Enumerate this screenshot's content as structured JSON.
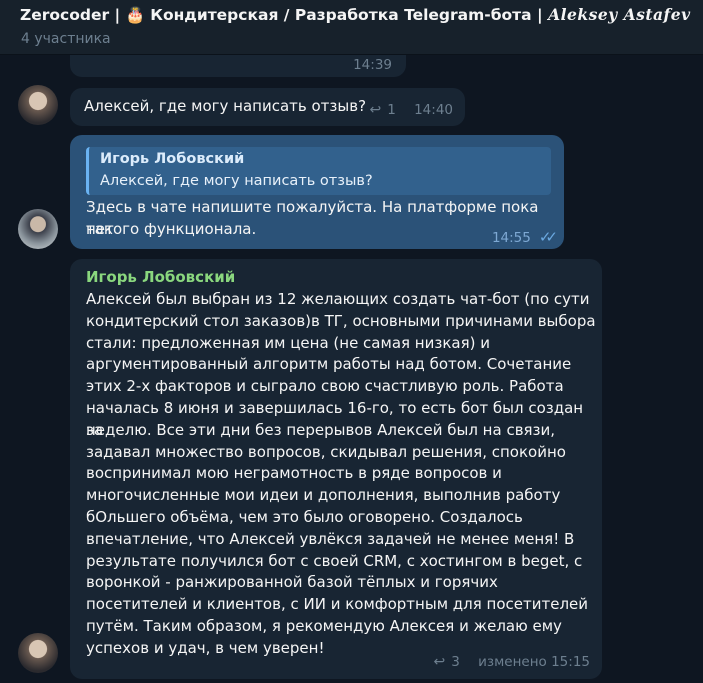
{
  "header": {
    "title": "Zerocoder | 🎂 Кондитерская / Разработка Telegram-бота | ",
    "signature": "Aleksey Astafev",
    "subtitle": "4 участника"
  },
  "messages": [
    {
      "id": "m0",
      "time": "14:39"
    },
    {
      "id": "m1",
      "text": "Алексей, где могу написать отзыв?",
      "replies": "1",
      "time": "14:40"
    },
    {
      "id": "m2",
      "quote_author": "Игорь Лобовский",
      "quote_text": "Алексей, где могу написать отзыв?",
      "text_lines": [
        "Здесь в чате напишите пожалуйста. На платформе пока нет",
        "такого функционала."
      ],
      "time": "14:55",
      "status": "read"
    },
    {
      "id": "m3",
      "author": "Игорь Лобовский",
      "text_lines": [
        "Алексей был выбран из 12 желающих создать чат-бот (по сути",
        "кондитерский стол заказов)в ТГ, основными причинами выбора",
        "стали: предложенная им цена (не самая низкая) и",
        "аргументированный алгоритм работы над ботом. Сочетание",
        "этих 2-х факторов и сыграло свою счастливую роль. Работа",
        "началась 8 июня и завершилась 16-го, то есть бот был создан за",
        "неделю. Все эти дни без перерывов Алексей был на связи,",
        "задавал множество вопросов, скидывал решения, спокойно",
        "воспринимал мою неграмотность в ряде вопросов и",
        "многочисленные мои идеи и дополнения, выполнив работу",
        "бОльшего объёма, чем это было оговорено. Создалось",
        "впечатление, что Алексей увлёкся задачей не менее меня! В",
        "результате получился бот с своей CRM, с хостингом в beget, с",
        "воронкой - ранжированной базой тёплых и горячих",
        "посетителей и клиентов, с ИИ и комфортным для посетителей",
        "путём.  Таким образом, я рекомендую Алексея и желаю ему",
        "успехов и удач, в чем уверен!"
      ],
      "replies": "3",
      "time": "изменено 15:15"
    }
  ],
  "icons": {
    "reply": "reply-arrow-icon",
    "read": "double-check-icon"
  },
  "colors": {
    "bg": "#0e1621",
    "incoming": "#182533",
    "outgoing": "#2b5278",
    "accent_green": "#8ad77e"
  }
}
